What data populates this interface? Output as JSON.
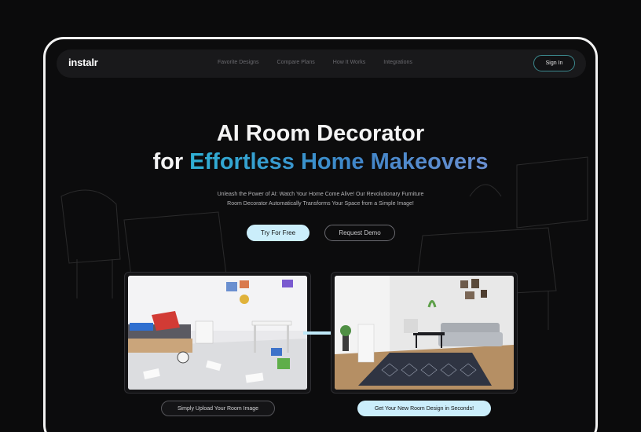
{
  "brand": {
    "logo_text": "instalr"
  },
  "nav": {
    "links": [
      {
        "label": "Favorite Designs"
      },
      {
        "label": "Compare Plans"
      },
      {
        "label": "How It Works"
      },
      {
        "label": "Integrations"
      }
    ],
    "signin_label": "Sign In"
  },
  "hero": {
    "title_line1": "AI Room Decorator",
    "title_line2_prefix": "for ",
    "title_line2_highlight": "Effortless Home Makeovers",
    "subtitle_line1": "Unleash the Power of AI: Watch Your Home Come Alive! Our Revolutionary Furniture",
    "subtitle_line2": "Room Decorator Automatically Transforms Your Space from a Simple Image!",
    "primary_cta": "Try For Free",
    "secondary_cta": "Request Demo"
  },
  "comparison": {
    "before_image": "messy-room-photo",
    "after_image": "decorated-living-room-photo",
    "arrow_icon": "arrow-right-icon",
    "upload_label": "Simply Upload Your Room Image",
    "result_label": "Get Your New Room Design in Seconds!"
  },
  "colors": {
    "background": "#0b0b0c",
    "accent_light": "#cbeefb",
    "gradient_start": "#2fb0d4",
    "gradient_end": "#6a8fd0",
    "signin_border": "#3c8a8f"
  }
}
